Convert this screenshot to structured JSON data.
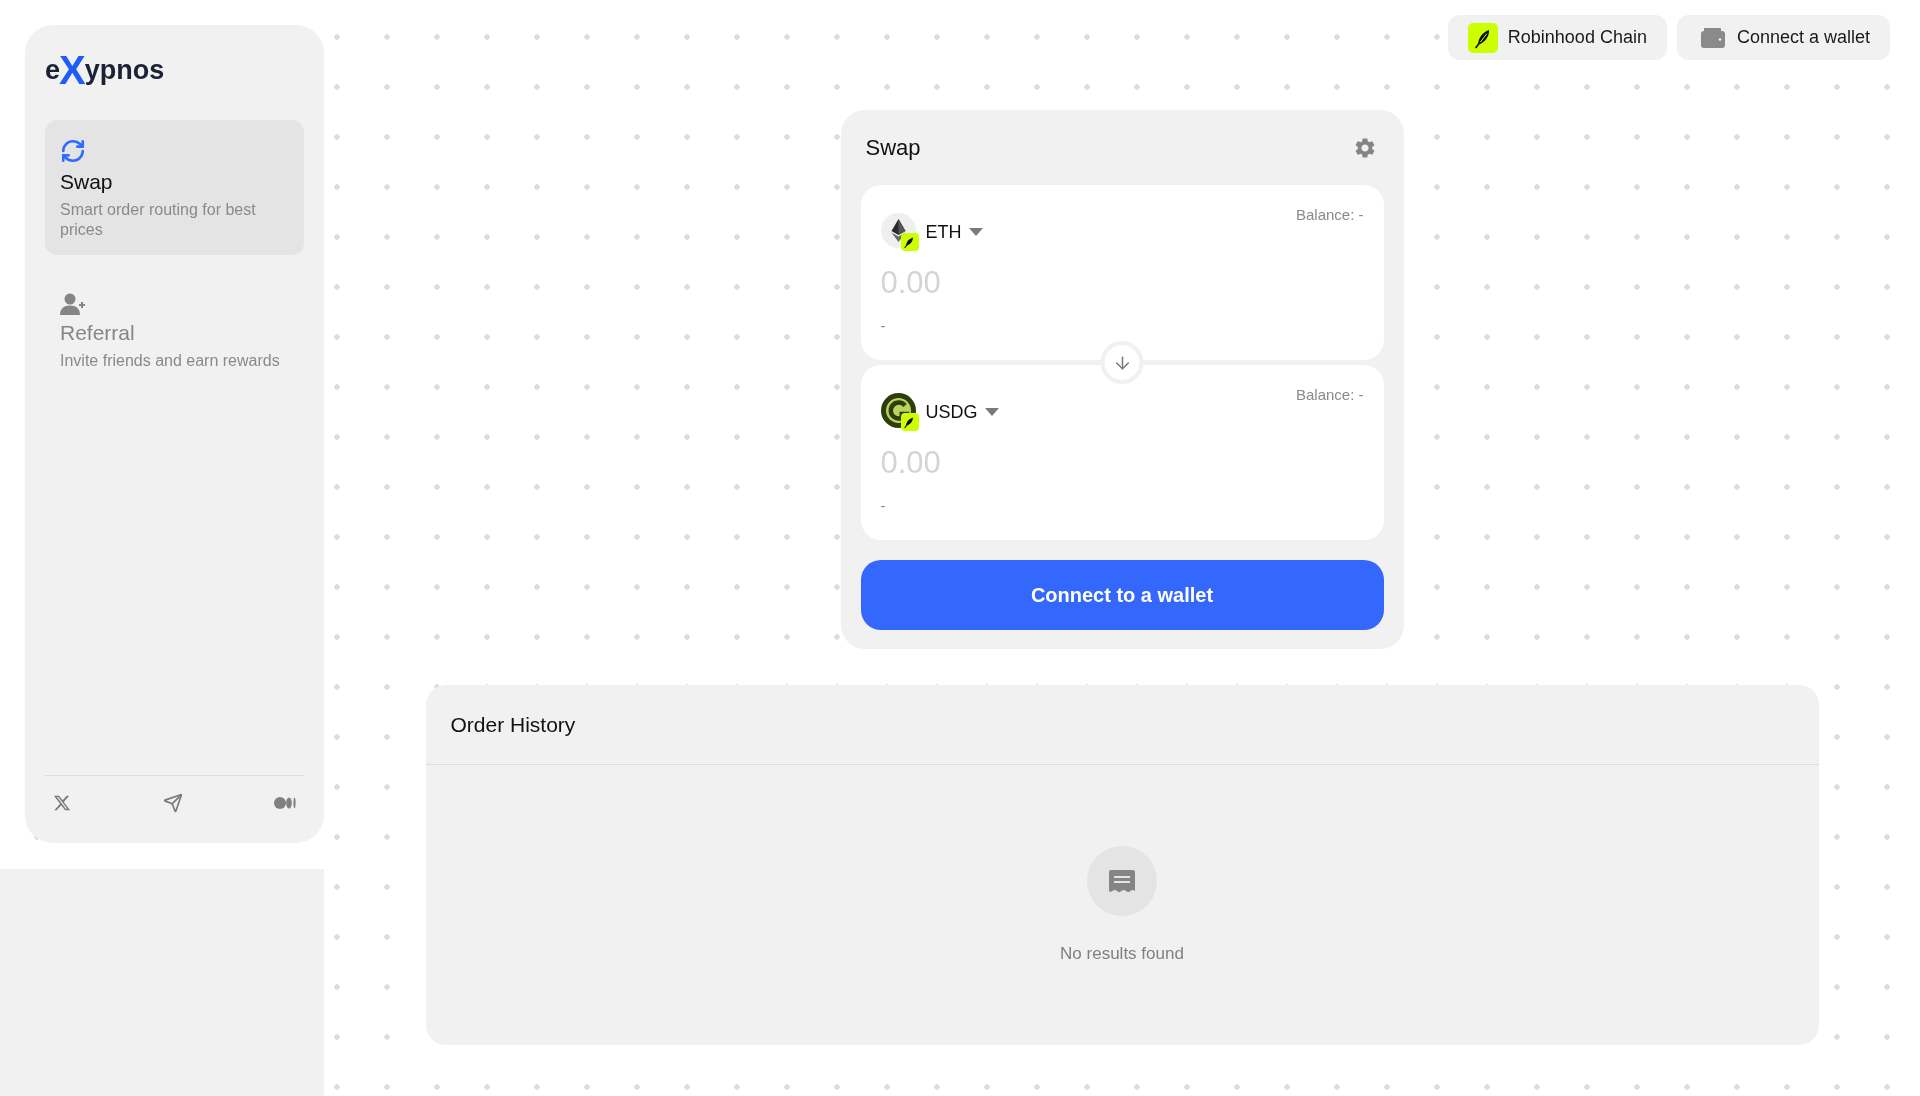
{
  "sidebar": {
    "logo": [
      {
        "text": "e",
        "accent": false
      },
      {
        "text": "X",
        "accent": true
      },
      {
        "text": "ypnos",
        "accent": false
      }
    ],
    "nav_items": [
      {
        "title": "Swap",
        "description": "Smart order routing for best prices",
        "selected": true
      },
      {
        "title": "Referral",
        "description": "Invite friends and earn rewards",
        "selected": false
      }
    ]
  },
  "header": {
    "network_button": {
      "label": "Robinhood Chain"
    },
    "wallet_button": {
      "label": "Connect a wallet"
    }
  },
  "swap_card": {
    "title": "Swap",
    "from": {
      "token": "ETH",
      "balance": "Balance: -",
      "amount_placeholder": "0.00",
      "fiat_value": "-"
    },
    "to": {
      "token": "USDG",
      "balance": "Balance: -",
      "amount_placeholder": "0.00",
      "fiat_value": "-"
    },
    "submit_button": {
      "label": "Connect to a wallet"
    }
  },
  "order_history": {
    "title": "Order History",
    "empty_message": "No results found"
  }
}
